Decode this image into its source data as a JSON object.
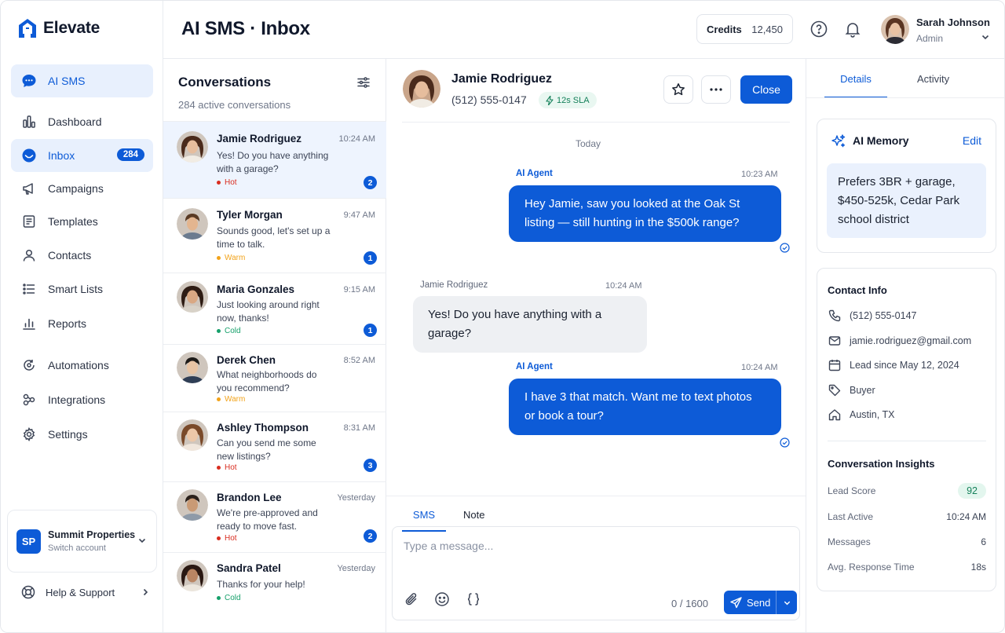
{
  "brand": {
    "name": "Elevate"
  },
  "nav": {
    "items": [
      {
        "label": "AI SMS",
        "icon": "chat-bubble-icon"
      },
      {
        "label": "Dashboard",
        "icon": "dashboard-icon"
      },
      {
        "label": "Inbox",
        "icon": "inbox-icon",
        "badge": "284"
      },
      {
        "label": "Campaigns",
        "icon": "megaphone-icon"
      },
      {
        "label": "Templates",
        "icon": "template-icon"
      },
      {
        "label": "Contacts",
        "icon": "person-icon"
      },
      {
        "label": "Smart Lists",
        "icon": "list-icon"
      },
      {
        "label": "Reports",
        "icon": "bar-chart-icon"
      },
      {
        "label": "Automations",
        "icon": "automation-icon"
      },
      {
        "label": "Integrations",
        "icon": "integrations-icon"
      },
      {
        "label": "Settings",
        "icon": "gear-icon"
      }
    ]
  },
  "account": {
    "initials": "SP",
    "name": "Summit Properties",
    "sub": "Switch account"
  },
  "help": {
    "label": "Help & Support"
  },
  "header": {
    "title": "AI SMS · Inbox",
    "credits_label": "Credits",
    "credits_value": "12,450",
    "user_name": "Sarah Johnson",
    "user_role": "Admin"
  },
  "conversations": {
    "title": "Conversations",
    "subtitle": "284 active conversations",
    "items": [
      {
        "name": "Jamie Rodriguez",
        "time": "10:24 AM",
        "msg": "Yes! Do you have anything with a garage?",
        "tag": "Hot",
        "badge": "2"
      },
      {
        "name": "Tyler Morgan",
        "time": "9:47 AM",
        "msg": "Sounds good, let's set up a time to talk.",
        "tag": "Warm",
        "badge": "1"
      },
      {
        "name": "Maria Gonzales",
        "time": "9:15 AM",
        "msg": "Just looking around right now, thanks!",
        "tag": "Cold",
        "badge": "1"
      },
      {
        "name": "Derek Chen",
        "time": "8:52 AM",
        "msg": "What neighborhoods do you recommend?",
        "tag": "Warm",
        "badge": ""
      },
      {
        "name": "Ashley Thompson",
        "time": "8:31 AM",
        "msg": "Can you send me some new listings?",
        "tag": "Hot",
        "badge": "3"
      },
      {
        "name": "Brandon Lee",
        "time": "Yesterday",
        "msg": "We're pre-approved and ready to move fast.",
        "tag": "Hot",
        "badge": "2"
      },
      {
        "name": "Sandra Patel",
        "time": "Yesterday",
        "msg": "Thanks for your help!",
        "tag": "Cold",
        "badge": ""
      }
    ]
  },
  "tag_colors": {
    "Hot": "#d92d20",
    "Warm": "#f2a31b",
    "Cold": "#16a06b"
  },
  "chat": {
    "name": "Jamie Rodriguez",
    "phone": "(512) 555-0147",
    "sla": "12s SLA",
    "close_label": "Close",
    "day_label": "Today",
    "messages": [
      {
        "sender": "AI Agent",
        "time": "10:23 AM",
        "text": "Hey Jamie, saw you looked at the Oak St listing — still hunting in the $500k range?"
      },
      {
        "sender": "Jamie Rodriguez",
        "time": "10:24 AM",
        "text": "Yes! Do you have anything with a garage?"
      },
      {
        "sender": "AI Agent",
        "time": "10:24 AM",
        "text": "I have 3 that match. Want me to text photos or book a tour?"
      }
    ],
    "tabs": [
      "SMS",
      "Note"
    ],
    "placeholder": "Type a message...",
    "counter": "0 / 1600",
    "send_label": "Send"
  },
  "details": {
    "tabs": [
      "Details",
      "Activity"
    ],
    "memory_title": "AI Memory",
    "memory_edit": "Edit",
    "memory_text": "Prefers 3BR + garage, $450-525k, Cedar Park school district",
    "contact_title": "Contact Info",
    "phone": "(512) 555-0147",
    "email": "jamie.rodriguez@gmail.com",
    "lead_since": "Lead since May 12, 2024",
    "type": "Buyer",
    "location": "Austin, TX",
    "insights_title": "Conversation Insights",
    "insights": [
      {
        "label": "Lead Score",
        "value": "92"
      },
      {
        "label": "Last Active",
        "value": "10:24 AM"
      },
      {
        "label": "Messages",
        "value": "6"
      },
      {
        "label": "Avg. Response Time",
        "value": "18s"
      }
    ]
  }
}
